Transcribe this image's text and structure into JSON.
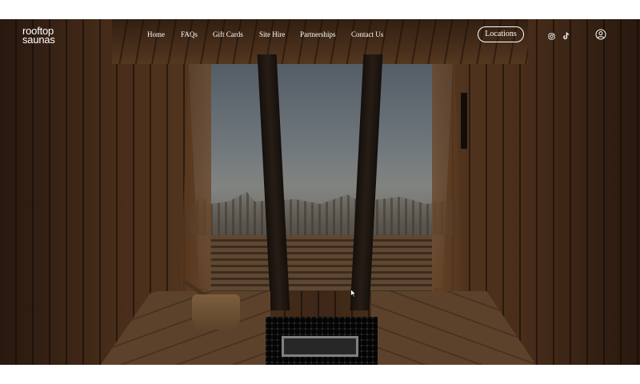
{
  "brand": {
    "line1": "rooftop",
    "line2": "saunas"
  },
  "nav": {
    "items": [
      {
        "label": "Home"
      },
      {
        "label": "FAQs"
      },
      {
        "label": "Gift Cards"
      },
      {
        "label": "Site Hire"
      },
      {
        "label": "Partnerships"
      },
      {
        "label": "Contact Us"
      }
    ],
    "locations_label": "Locations"
  },
  "icons": {
    "instagram": "instagram-icon",
    "tiktok": "tiktok-icon",
    "account": "account-icon"
  },
  "colors": {
    "nav_text": "#ffffff",
    "page_bg": "#ffffff"
  }
}
